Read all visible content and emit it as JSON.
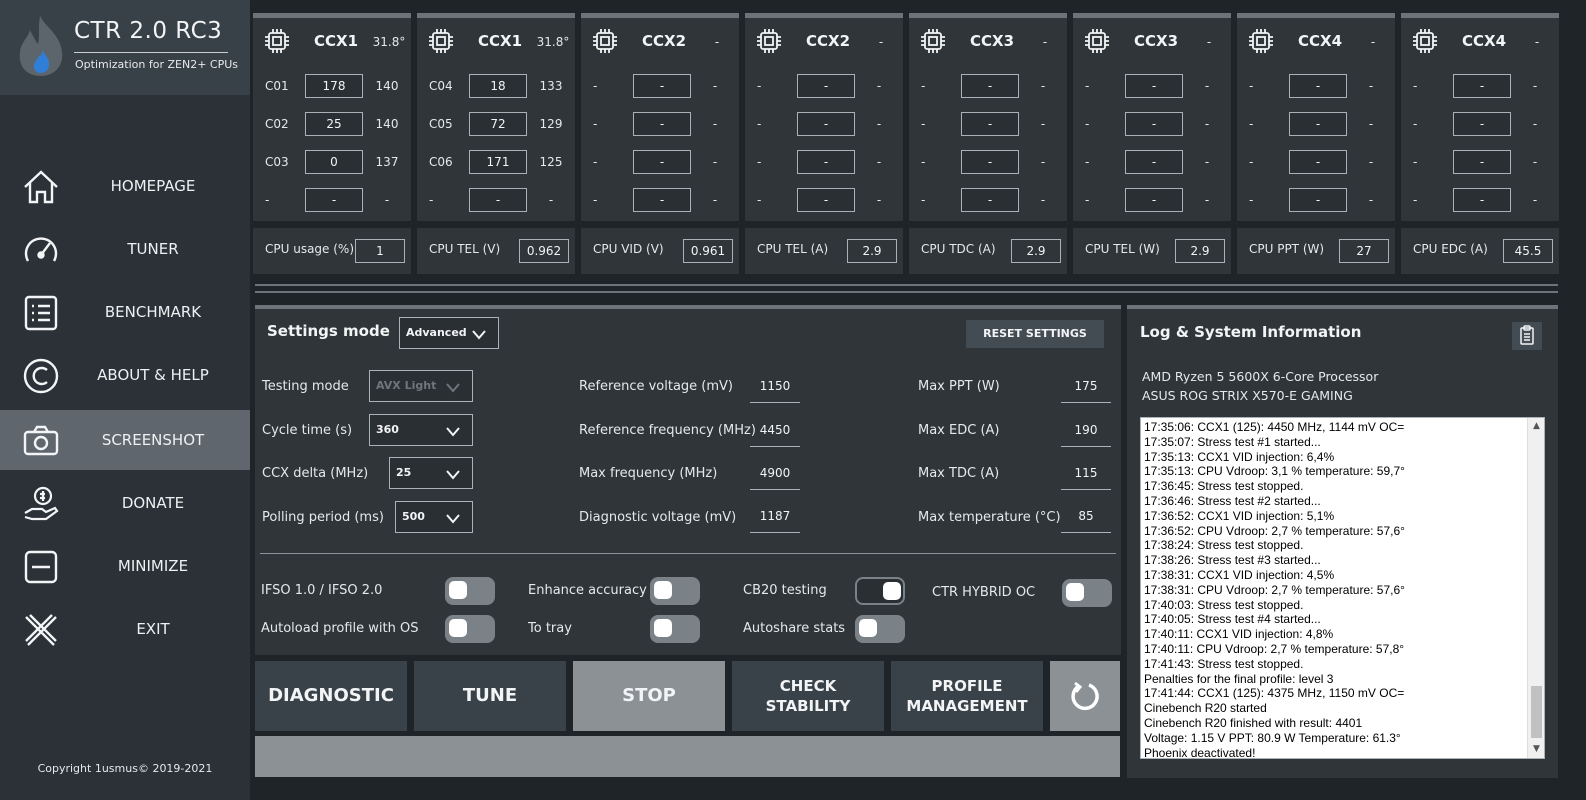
{
  "app": {
    "title": "CTR 2.0 RC3",
    "subtitle": "Optimization for ZEN2+ CPUs",
    "copyright": "Copyright 1usmus© 2019-2021"
  },
  "nav": [
    {
      "label": "HOMEPAGE",
      "icon": "home-icon"
    },
    {
      "label": "TUNER",
      "icon": "gauge-icon"
    },
    {
      "label": "BENCHMARK",
      "icon": "list-icon"
    },
    {
      "label": "ABOUT & HELP",
      "icon": "copyright-icon"
    },
    {
      "label": "SCREENSHOT",
      "icon": "camera-icon",
      "active": true
    },
    {
      "label": "DONATE",
      "icon": "donate-hand-icon"
    },
    {
      "label": "MINIMIZE",
      "icon": "minimize-icon"
    },
    {
      "label": "EXIT",
      "icon": "close-icon"
    }
  ],
  "ccx": [
    {
      "name": "CCX1",
      "temp": "31.8°",
      "rows": [
        {
          "label": "C01",
          "value": "178",
          "extra": "140"
        },
        {
          "label": "C02",
          "value": "25",
          "extra": "140"
        },
        {
          "label": "C03",
          "value": "0",
          "extra": "137"
        },
        {
          "label": "-",
          "value": "-",
          "extra": "-"
        }
      ]
    },
    {
      "name": "CCX1",
      "temp": "31.8°",
      "rows": [
        {
          "label": "C04",
          "value": "18",
          "extra": "133"
        },
        {
          "label": "C05",
          "value": "72",
          "extra": "129"
        },
        {
          "label": "C06",
          "value": "171",
          "extra": "125"
        },
        {
          "label": "-",
          "value": "-",
          "extra": "-"
        }
      ]
    },
    {
      "name": "CCX2",
      "temp": "-",
      "rows": [
        {
          "label": "-",
          "value": "-",
          "extra": "-"
        },
        {
          "label": "-",
          "value": "-",
          "extra": "-"
        },
        {
          "label": "-",
          "value": "-",
          "extra": "-"
        },
        {
          "label": "-",
          "value": "-",
          "extra": "-"
        }
      ]
    },
    {
      "name": "CCX2",
      "temp": "-",
      "rows": [
        {
          "label": "-",
          "value": "-",
          "extra": "-"
        },
        {
          "label": "-",
          "value": "-",
          "extra": "-"
        },
        {
          "label": "-",
          "value": "-",
          "extra": "-"
        },
        {
          "label": "-",
          "value": "-",
          "extra": "-"
        }
      ]
    },
    {
      "name": "CCX3",
      "temp": "-",
      "rows": [
        {
          "label": "-",
          "value": "-",
          "extra": "-"
        },
        {
          "label": "-",
          "value": "-",
          "extra": "-"
        },
        {
          "label": "-",
          "value": "-",
          "extra": "-"
        },
        {
          "label": "-",
          "value": "-",
          "extra": "-"
        }
      ]
    },
    {
      "name": "CCX3",
      "temp": "-",
      "rows": [
        {
          "label": "-",
          "value": "-",
          "extra": "-"
        },
        {
          "label": "-",
          "value": "-",
          "extra": "-"
        },
        {
          "label": "-",
          "value": "-",
          "extra": "-"
        },
        {
          "label": "-",
          "value": "-",
          "extra": "-"
        }
      ]
    },
    {
      "name": "CCX4",
      "temp": "-",
      "rows": [
        {
          "label": "-",
          "value": "-",
          "extra": "-"
        },
        {
          "label": "-",
          "value": "-",
          "extra": "-"
        },
        {
          "label": "-",
          "value": "-",
          "extra": "-"
        },
        {
          "label": "-",
          "value": "-",
          "extra": "-"
        }
      ]
    },
    {
      "name": "CCX4",
      "temp": "-",
      "rows": [
        {
          "label": "-",
          "value": "-",
          "extra": "-"
        },
        {
          "label": "-",
          "value": "-",
          "extra": "-"
        },
        {
          "label": "-",
          "value": "-",
          "extra": "-"
        },
        {
          "label": "-",
          "value": "-",
          "extra": "-"
        }
      ]
    }
  ],
  "metrics": [
    {
      "label": "CPU usage (%)",
      "value": "1"
    },
    {
      "label": "CPU TEL (V)",
      "value": "0.962"
    },
    {
      "label": "CPU VID (V)",
      "value": "0.961"
    },
    {
      "label": "CPU TEL (A)",
      "value": "2.9"
    },
    {
      "label": "CPU TDC (A)",
      "value": "2.9"
    },
    {
      "label": "CPU TEL (W)",
      "value": "2.9"
    },
    {
      "label": "CPU PPT (W)",
      "value": "27"
    },
    {
      "label": "CPU EDC (A)",
      "value": "45.5"
    }
  ],
  "settings": {
    "title": "Settings mode",
    "mode": "Advanced",
    "reset_label": "RESET SETTINGS",
    "testing_mode": {
      "label": "Testing mode",
      "value": "AVX Light"
    },
    "cycle_time": {
      "label": "Cycle time (s)",
      "value": "360"
    },
    "ccx_delta": {
      "label": "CCX delta (MHz)",
      "value": "25"
    },
    "polling_period": {
      "label": "Polling period (ms)",
      "value": "500"
    },
    "reference_voltage": {
      "label": "Reference voltage (mV)",
      "value": "1150"
    },
    "reference_frequency": {
      "label": "Reference frequency (MHz)",
      "value": "4450"
    },
    "max_frequency": {
      "label": "Max frequency (MHz)",
      "value": "4900"
    },
    "diagnostic_voltage": {
      "label": "Diagnostic voltage (mV)",
      "value": "1187"
    },
    "max_ppt": {
      "label": "Max PPT (W)",
      "value": "175"
    },
    "max_edc": {
      "label": "Max EDC (A)",
      "value": "190"
    },
    "max_tdc": {
      "label": "Max TDC (A)",
      "value": "115"
    },
    "max_temperature": {
      "label": "Max temperature (°C)",
      "value": "85"
    },
    "toggles": {
      "ifso": {
        "label": "IFSO 1.0 / IFSO 2.0",
        "on": false
      },
      "enhance_accuracy": {
        "label": "Enhance accuracy",
        "on": false
      },
      "cb20_testing": {
        "label": "CB20 testing",
        "on": true
      },
      "ctr_hybrid_oc": {
        "label": "CTR HYBRID OC",
        "on": false
      },
      "autoload_profile": {
        "label": "Autoload profile with OS",
        "on": false
      },
      "to_tray": {
        "label": "To tray",
        "on": false
      },
      "autoshare_stats": {
        "label": "Autoshare stats",
        "on": false
      }
    }
  },
  "actions": {
    "diagnostic": "DIAGNOSTIC",
    "tune": "TUNE",
    "stop": "STOP",
    "check_stability_1": "CHECK",
    "check_stability_2": "STABILITY",
    "profile_management_1": "PROFILE",
    "profile_management_2": "MANAGEMENT"
  },
  "progress": {
    "value": 0
  },
  "log": {
    "title": "Log & System Information",
    "cpu": "AMD Ryzen 5 5600X 6-Core Processor",
    "board": "ASUS ROG STRIX X570-E GAMING",
    "lines": [
      "17:35:06: CCX1 (125): 4450 MHz, 1144 mV  OC=",
      "17:35:07: Stress test #1 started...",
      "17:35:13: CCX1 VID injection: 6,4%",
      "17:35:13: CPU Vdroop: 3,1 % temperature: 59,7°",
      "17:36:45: Stress test stopped.",
      "17:36:46: Stress test #2 started...",
      "17:36:52: CCX1 VID injection: 5,1%",
      "17:36:52: CPU Vdroop: 2,7 % temperature: 57,6°",
      "17:38:24: Stress test stopped.",
      "17:38:26: Stress test #3 started...",
      "17:38:31: CCX1 VID injection: 4,5%",
      "17:38:31: CPU Vdroop: 2,7 % temperature: 57,6°",
      "17:40:03: Stress test stopped.",
      "17:40:05: Stress test #4 started...",
      "17:40:11: CCX1 VID injection: 4,8%",
      "17:40:11: CPU Vdroop: 2,7 % temperature: 57,8°",
      "17:41:43: Stress test stopped.",
      "Penalties for the final profile: level 3",
      "17:41:44: CCX1 (125): 4375 MHz, 1150 mV  OC=",
      "Cinebench R20 started",
      "Cinebench R20 finished with result: 4401",
      "Voltage: 1.15 V  PPT: 80.9 W  Temperature: 61.3°",
      "Phoenix deactivated!"
    ]
  },
  "colors": {
    "sidebar": "#2b3137",
    "brand": "#394148",
    "active_nav": "#5f666d",
    "panel": "#2f3538",
    "button": "#3a4249",
    "stop_button": "#8c9196",
    "accent_flame": "#2f7fd8"
  }
}
